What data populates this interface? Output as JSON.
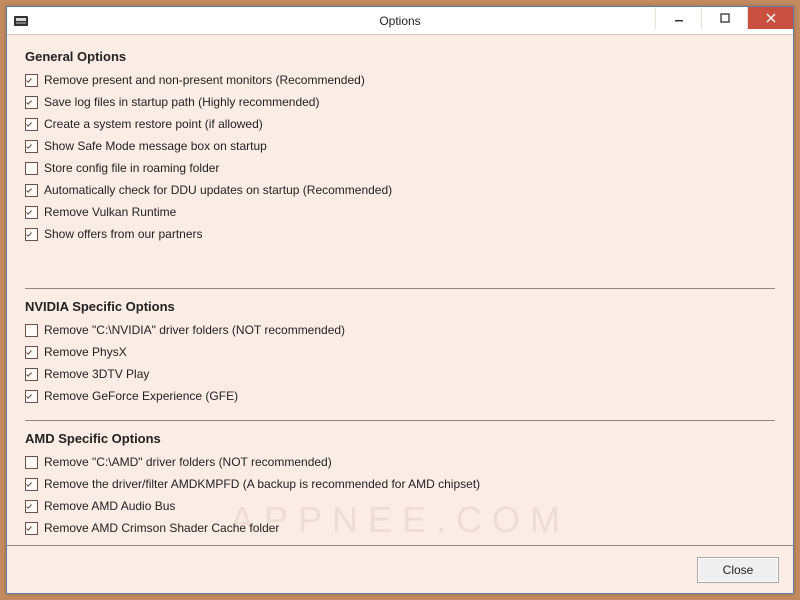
{
  "window": {
    "title": "Options"
  },
  "watermark": "APPNEE.COM",
  "footer": {
    "close_label": "Close"
  },
  "sections": {
    "general": {
      "title": "General Options",
      "options": [
        {
          "label": "Remove present and non-present monitors (Recommended)",
          "checked": true
        },
        {
          "label": "Save log files in startup path (Highly recommended)",
          "checked": true
        },
        {
          "label": "Create a system restore point (if allowed)",
          "checked": true
        },
        {
          "label": "Show Safe Mode message box on startup",
          "checked": true
        },
        {
          "label": "Store config file in roaming folder",
          "checked": false
        },
        {
          "label": "Automatically check for DDU updates on startup (Recommended)",
          "checked": true
        },
        {
          "label": "Remove Vulkan Runtime",
          "checked": true
        },
        {
          "label": "Show offers from our partners",
          "checked": true
        }
      ]
    },
    "nvidia": {
      "title": "NVIDIA Specific Options",
      "options": [
        {
          "label": "Remove \"C:\\NVIDIA\" driver folders (NOT recommended)",
          "checked": false
        },
        {
          "label": "Remove PhysX",
          "checked": true
        },
        {
          "label": "Remove 3DTV Play",
          "checked": true
        },
        {
          "label": "Remove GeForce Experience (GFE)",
          "checked": true
        }
      ]
    },
    "amd": {
      "title": "AMD Specific Options",
      "options": [
        {
          "label": "Remove \"C:\\AMD\" driver folders (NOT recommended)",
          "checked": false
        },
        {
          "label": "Remove the driver/filter AMDKMPFD (A backup is recommended for AMD chipset)",
          "checked": true
        },
        {
          "label": "Remove AMD Audio Bus",
          "checked": true
        },
        {
          "label": "Remove AMD Crimson Shader Cache folder",
          "checked": true
        }
      ]
    }
  }
}
